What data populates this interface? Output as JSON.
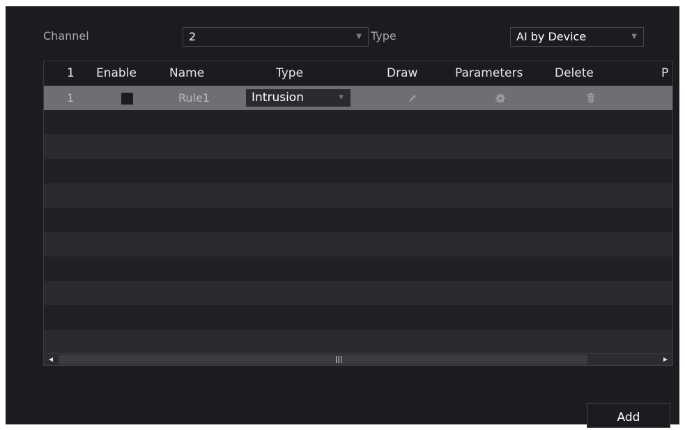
{
  "filters": {
    "channel_label": "Channel",
    "channel_value": "2",
    "type_label": "Type",
    "type_value": "AI by Device"
  },
  "table": {
    "columns": [
      "1",
      "Enable",
      "Name",
      "Type",
      "Draw",
      "Parameters",
      "Delete",
      "P"
    ],
    "rows": [
      {
        "index": "1",
        "enabled": false,
        "name": "Rule1",
        "type": "Intrusion",
        "draw_icon": "pencil-icon",
        "parameters_icon": "gear-icon",
        "delete_icon": "trash-icon"
      }
    ]
  },
  "scrollbar": {
    "left_arrow": "◀",
    "right_arrow": "▶"
  },
  "actions": {
    "add_label": "Add"
  },
  "colors": {
    "panel_background": "#1b1c1f",
    "selected_row": "#6e6f74",
    "text_primary": "#ffffff",
    "text_secondary": "#a6a7aa"
  }
}
